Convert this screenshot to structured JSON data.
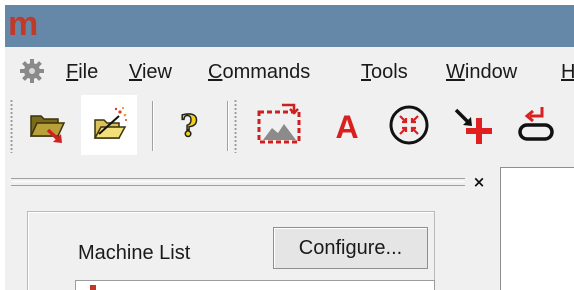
{
  "app": {
    "logo_text": "m",
    "title_bar_color": "#6588a8",
    "accent_red": "#c0392b"
  },
  "menu": {
    "system_icon": "gear-icon",
    "items": [
      {
        "accel": "F",
        "rest": "ile"
      },
      {
        "accel": "V",
        "rest": "iew"
      },
      {
        "accel": "C",
        "rest": "ommands"
      },
      {
        "accel": "T",
        "rest": "ools"
      },
      {
        "accel": "W",
        "rest": "indow"
      },
      {
        "accel": "H",
        "rest": ""
      }
    ]
  },
  "toolbar": {
    "buttons": [
      {
        "icon": "open-folder-arrow-icon",
        "highlighted": false
      },
      {
        "icon": "open-folder-sparkle-icon",
        "highlighted": true
      },
      {
        "icon": "help-question-icon",
        "highlighted": false
      },
      {
        "icon": "dashed-frame-icon",
        "highlighted": false
      },
      {
        "icon": "text-a-icon",
        "highlighted": false
      },
      {
        "icon": "circle-target-icon",
        "highlighted": false
      },
      {
        "icon": "arrow-plus-icon",
        "highlighted": false
      },
      {
        "icon": "return-shape-icon",
        "highlighted": false
      }
    ]
  },
  "panel": {
    "close_label": "×",
    "machine_list_label": "Machine List",
    "configure_label": "Configure..."
  }
}
